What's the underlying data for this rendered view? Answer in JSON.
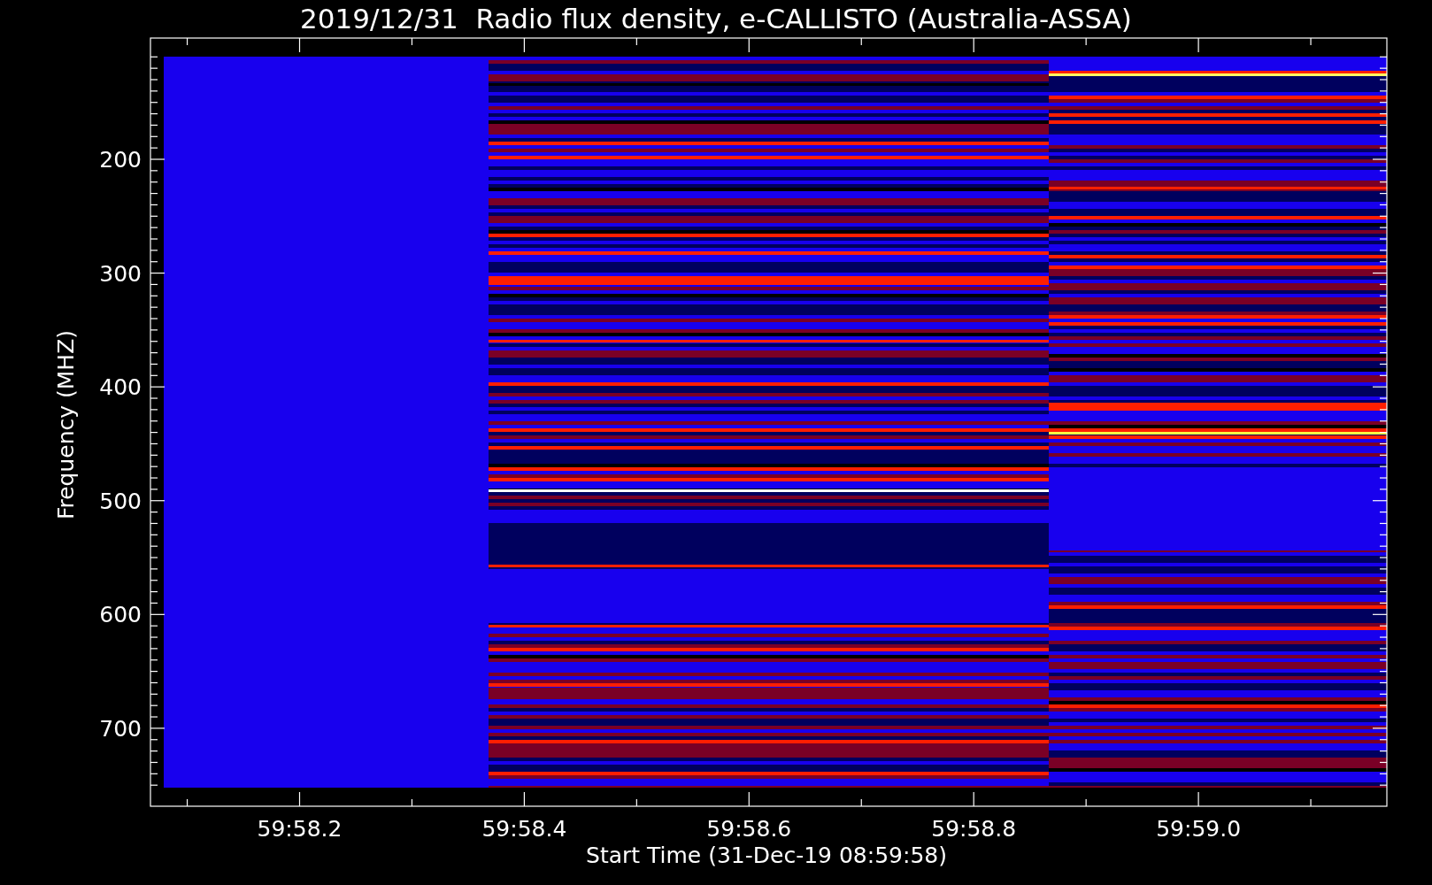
{
  "title": "2019/12/31  Radio flux density, e-CALLISTO (Australia-ASSA)",
  "plot": {
    "xlabel": "Start Time (31-Dec-19 08:59:58)",
    "ylabel": "Frequency (MHZ)",
    "yticks": [
      "200",
      "300",
      "400",
      "500",
      "600",
      "700"
    ],
    "xticks": [
      "59:58.2",
      "59:58.4",
      "59:58.6",
      "59:58.8",
      "59:59.0"
    ]
  }
}
